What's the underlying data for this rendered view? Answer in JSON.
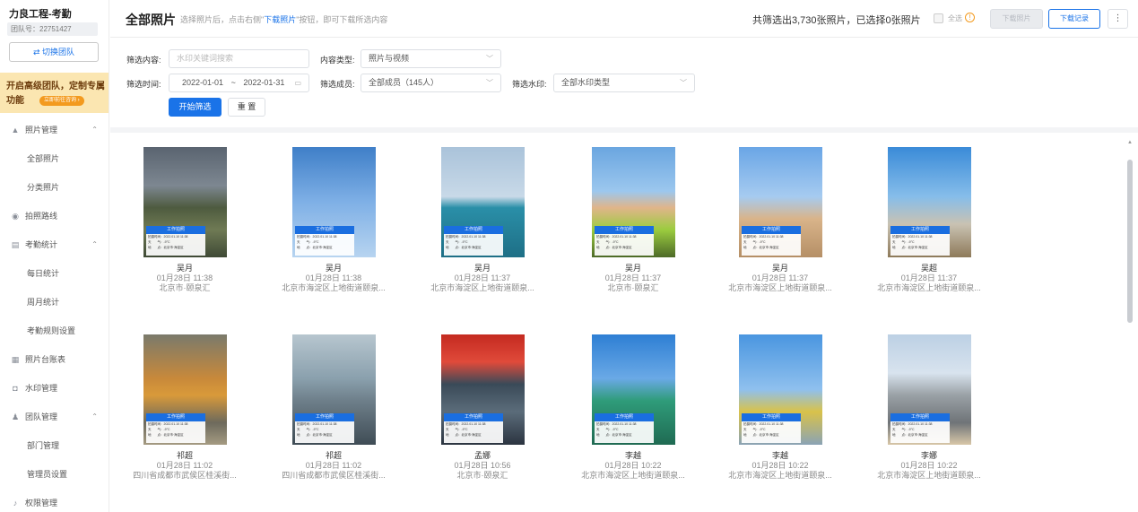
{
  "sidebar": {
    "team_name": "力良工程-考勤",
    "team_id": "团队号：22751427",
    "switch_label": "⇄ 切换团队",
    "promo_title": "开启高级团队，定制专属功能",
    "promo_btn": "立即前往咨询 ›",
    "menu": [
      {
        "label": "照片管理",
        "icon": "photo-icon",
        "expanded": true
      },
      {
        "label": "全部照片"
      },
      {
        "label": "分类照片"
      },
      {
        "label": "拍照路线",
        "icon": "route-icon"
      },
      {
        "label": "考勤统计",
        "icon": "stats-icon",
        "expanded": true
      },
      {
        "label": "每日统计"
      },
      {
        "label": "周月统计"
      },
      {
        "label": "考勤规则设置"
      },
      {
        "label": "照片台账表",
        "icon": "ledger-icon"
      },
      {
        "label": "水印管理",
        "icon": "watermark-icon"
      },
      {
        "label": "团队管理",
        "icon": "team-icon",
        "expanded": true
      },
      {
        "label": "部门管理"
      },
      {
        "label": "管理员设置"
      },
      {
        "label": "权限管理",
        "icon": "bell-icon"
      }
    ]
  },
  "header": {
    "title": "全部照片",
    "hint_pre": "选择照片后，点击右侧\"",
    "hint_link": "下载照片",
    "hint_post": "\"按钮，即可下载所选内容",
    "count_text": "共筛选出3,730张照片，已选择0张照片",
    "select_all": "全选",
    "download_photo": "下载照片",
    "download_record": "下载记录",
    "more": "⋮"
  },
  "filter": {
    "content_label": "筛选内容:",
    "content_placeholder": "水印关键词搜索",
    "type_label": "内容类型:",
    "type_value": "照片与视频",
    "time_label": "筛选时间:",
    "date_start": "2022-01-01",
    "date_sep": "~",
    "date_end": "2022-01-31",
    "member_label": "筛选成员:",
    "member_value": "全部成员（145人）",
    "watermark_label": "筛选水印:",
    "watermark_value": "全部水印类型",
    "search_btn": "开始筛选",
    "reset_btn": "重 置"
  },
  "watermark": {
    "title": "工作拍照",
    "line1": "拍摄时间：2022.01.10 11:38",
    "line2": "天　　气：-9°C",
    "line3": "地　　点：北京市·海淀区"
  },
  "photos": [
    {
      "name": "吴月",
      "time": "01月28日 11:38",
      "location": "北京市·颐泉汇",
      "theme": "city-night"
    },
    {
      "name": "吴月",
      "time": "01月28日 11:38",
      "location": "北京市海淀区上地街道颐泉...",
      "theme": "pylon"
    },
    {
      "name": "吴月",
      "time": "01月28日 11:37",
      "location": "北京市海淀区上地街道颐泉...",
      "theme": "building-blue"
    },
    {
      "name": "吴月",
      "time": "01月28日 11:37",
      "location": "北京市·颐泉汇",
      "theme": "worker"
    },
    {
      "name": "吴月",
      "time": "01月28日 11:37",
      "location": "北京市海淀区上地街道颐泉...",
      "theme": "crane-sky"
    },
    {
      "name": "吴超",
      "time": "01月28日 11:37",
      "location": "北京市海淀区上地街道颐泉...",
      "theme": "cranes-yellow"
    },
    {
      "name": "祁超",
      "time": "01月28日 11:02",
      "location": "四川省成都市武侯区桂溪街...",
      "theme": "excavator"
    },
    {
      "name": "祁超",
      "time": "01月28日 11:02",
      "location": "四川省成都市武侯区桂溪街...",
      "theme": "factory"
    },
    {
      "name": "孟娜",
      "time": "01月28日 10:56",
      "location": "北京市·颐泉汇",
      "theme": "redhat"
    },
    {
      "name": "李越",
      "time": "01月28日 10:22",
      "location": "北京市海淀区上地街道颐泉...",
      "theme": "tower-green"
    },
    {
      "name": "李越",
      "time": "01月28日 10:22",
      "location": "北京市海淀区上地街道颐泉...",
      "theme": "cranes-blue"
    },
    {
      "name": "李娜",
      "time": "01月28日 10:22",
      "location": "北京市海淀区上地街道颐泉...",
      "theme": "highrise"
    }
  ]
}
